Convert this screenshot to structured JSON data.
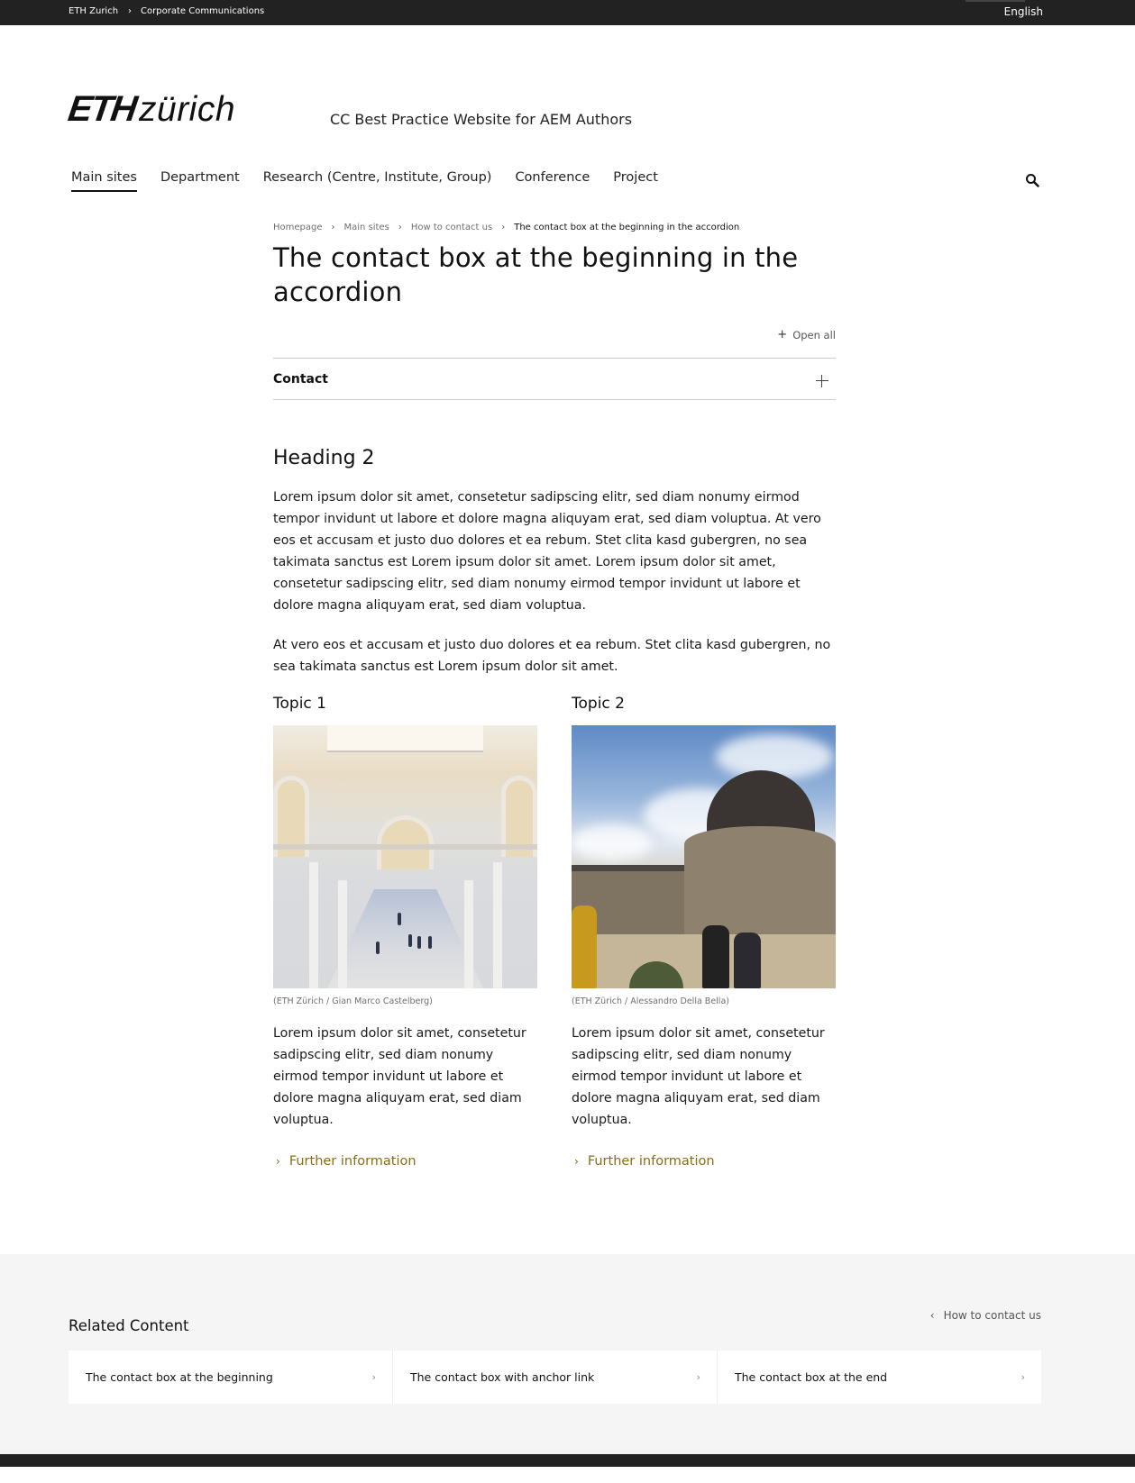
{
  "topbar": {
    "breadcrumb": [
      "ETH Zurich",
      "Corporate Communications"
    ],
    "separator": "›",
    "language": "English"
  },
  "header": {
    "logo_bold": "ETH",
    "logo_light": "zürich",
    "site_title": "CC Best Practice Website for AEM Authors",
    "nav": [
      {
        "label": "Main sites",
        "active": true
      },
      {
        "label": "Department",
        "active": false
      },
      {
        "label": "Research (Centre, Institute, Group)",
        "active": false
      },
      {
        "label": "Conference",
        "active": false
      },
      {
        "label": "Project",
        "active": false
      }
    ],
    "search_icon": "search-icon"
  },
  "breadcrumb": {
    "items": [
      "Homepage",
      "Main sites",
      "How to contact us"
    ],
    "current": "The contact box at the beginning in the accordion",
    "separator": "›"
  },
  "page": {
    "title": "The contact box at the beginning in the accordion",
    "open_all_icon": "+",
    "open_all": "Open all",
    "accordion": {
      "label": "Contact",
      "icon": "plus-icon"
    },
    "heading2": "Heading 2",
    "paragraph1": "Lorem ipsum dolor sit amet, consetetur sadipscing elitr, sed diam nonumy eirmod tempor invidunt ut labore et dolore magna aliquyam erat, sed diam voluptua. At vero eos et ac­cusam et justo duo dolores et ea rebum. Stet clita kasd gubergren, no sea takimata sanc­tus est Lorem ipsum dolor sit amet. Lorem ipsum dolor sit amet, consetetur sadipscing elitr, sed diam nonumy eirmod tempor invidunt ut labore et dolore magna aliquyam erat, sed diam voluptua.",
    "paragraph2": "At vero eos et accusam et justo duo dolores et ea rebum. Stet clita kasd gubergren, no sea takimata sanctus est Lorem ipsum dolor sit amet.",
    "topics": [
      {
        "title": "Topic 1",
        "image_alt": "Main hall of ETH Zurich main building with arcades",
        "caption": "(ETH Zürich / Gian Marco Castelberg)",
        "text": "Lorem ipsum dolor sit amet, consetetur sadipscing elitr, sed diam nonumy eirmod tempor invidunt ut labore et dolore magna aliquyam erat, sed diam voluptua.",
        "link_icon": "›",
        "link": "Further information"
      },
      {
        "title": "Topic 2",
        "image_alt": "ETH Zurich main building dome with people walking",
        "caption": "(ETH Zürich / Alessandro Della Bella)",
        "text": "Lorem ipsum dolor sit amet, consetetur sadipscing elitr, sed diam nonumy eirmod tempor invidunt ut labore et dolore magna aliquyam erat, sed diam voluptua.",
        "link_icon": "›",
        "link": "Further information"
      }
    ]
  },
  "related": {
    "title": "Related Content",
    "back_icon": "‹",
    "back_link": "How to contact us",
    "cards": [
      {
        "label": "The contact box at the beginning",
        "icon": "›"
      },
      {
        "label": "The contact box with anchor link",
        "icon": "›"
      },
      {
        "label": "The contact box at the end",
        "icon": "›"
      }
    ]
  },
  "colors": {
    "topbar_bg": "#222222",
    "link_accent": "#8a6d14",
    "related_bg": "#f5f5f5"
  }
}
